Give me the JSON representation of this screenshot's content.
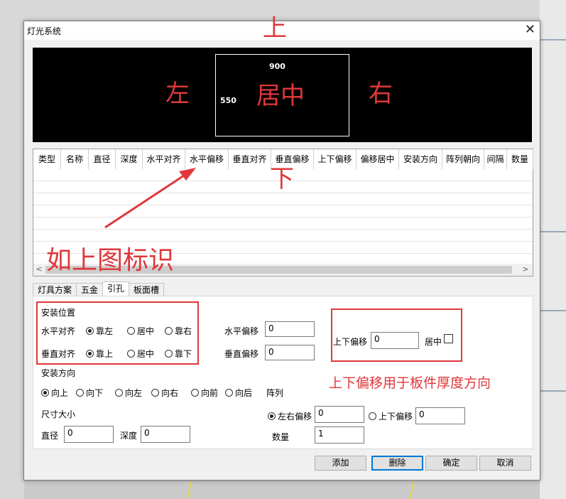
{
  "window": {
    "title": "灯光系统"
  },
  "annotations": {
    "top": "上",
    "left": "左",
    "center": "居中",
    "right": "右",
    "bottom": "下",
    "arrow_note": "如上图标识",
    "offset_note": "上下偏移用于板件厚度方向"
  },
  "preview": {
    "width": "900",
    "height": "550"
  },
  "grid": {
    "columns": [
      "类型",
      "名称",
      "直径",
      "深度",
      "水平对齐",
      "水平偏移",
      "垂直对齐",
      "垂直偏移",
      "上下偏移",
      "偏移居中",
      "安装方向",
      "阵列朝向",
      "间隔",
      "数量"
    ],
    "scroll_left": "<",
    "scroll_right": ">"
  },
  "tabs": [
    "灯具方案",
    "五金",
    "引孔",
    "板面槽"
  ],
  "form": {
    "install_position": "安装位置",
    "h_align_label": "水平对齐",
    "h_align_options": [
      "靠左",
      "居中",
      "靠右"
    ],
    "v_align_label": "垂直对齐",
    "v_align_options": [
      "靠上",
      "居中",
      "靠下"
    ],
    "h_offset_label": "水平偏移",
    "h_offset_value": "0",
    "v_offset_label": "垂直偏移",
    "v_offset_value": "0",
    "ud_offset_label": "上下偏移",
    "ud_offset_value": "0",
    "center_label": "居中",
    "install_direction": "安装方向",
    "directions": [
      "向上",
      "向下",
      "向左",
      "向右",
      "向前",
      "向后"
    ],
    "array_label": "阵列",
    "size_label": "尺寸大小",
    "diameter_label": "直径",
    "diameter_value": "0",
    "depth_label": "深度",
    "depth_value": "0",
    "lr_offset_label": "左右偏移",
    "lr_offset_value": "0",
    "array_ud_offset_label": "上下偏移",
    "array_ud_offset_value": "0",
    "count_label": "数量",
    "count_value": "1"
  },
  "buttons": {
    "add": "添加",
    "delete": "删除",
    "ok": "确定",
    "cancel": "取消"
  },
  "colors": {
    "annotation": "#e0373a",
    "preview_bg": "#000000",
    "default_button_border": "#0078d7"
  },
  "icons": {
    "close": "close-icon"
  }
}
